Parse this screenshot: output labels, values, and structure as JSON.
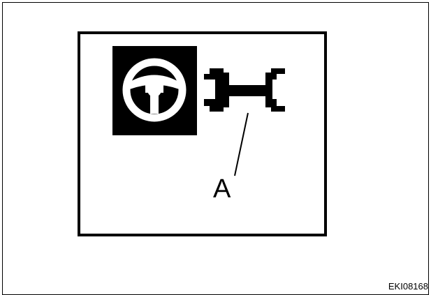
{
  "diagram": {
    "callout_label": "A",
    "image_code": "EKI08168",
    "icons": {
      "left": "steering-wheel-icon",
      "right": "wrench-icon"
    },
    "colors": {
      "ink": "#000000",
      "paper": "#ffffff"
    }
  }
}
